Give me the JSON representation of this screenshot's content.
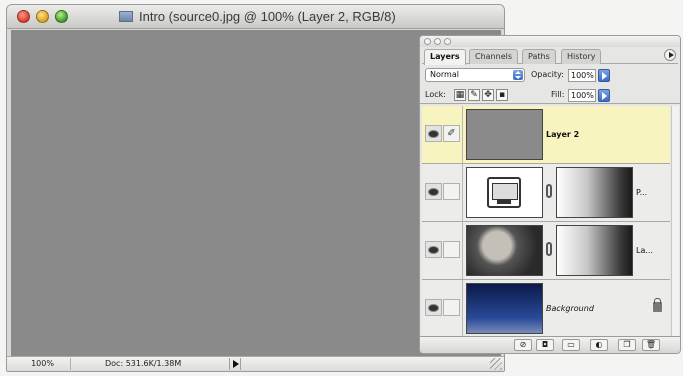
{
  "document": {
    "title": "Intro (source0.jpg @ 100% (Layer 2, RGB/8)",
    "zoom": "100%",
    "doc_size": "Doc: 531.6K/1.38M"
  },
  "palette": {
    "tabs": [
      {
        "label": "Layers"
      },
      {
        "label": "Channels"
      },
      {
        "label": "Paths"
      },
      {
        "label": "History"
      }
    ],
    "blend_mode": "Normal",
    "opacity_label": "Opacity:",
    "opacity_value": "100%",
    "lock_label": "Lock:",
    "fill_label": "Fill:",
    "fill_value": "100%",
    "layers": [
      {
        "name": "Layer 2",
        "selected": true
      },
      {
        "name": "P..."
      },
      {
        "name": "La..."
      },
      {
        "name": "Background"
      }
    ]
  },
  "colors": {
    "canvas": "#8a8a8b",
    "selected_layer": "#f7f4c0",
    "accent_blue": "#3b6cc8"
  }
}
